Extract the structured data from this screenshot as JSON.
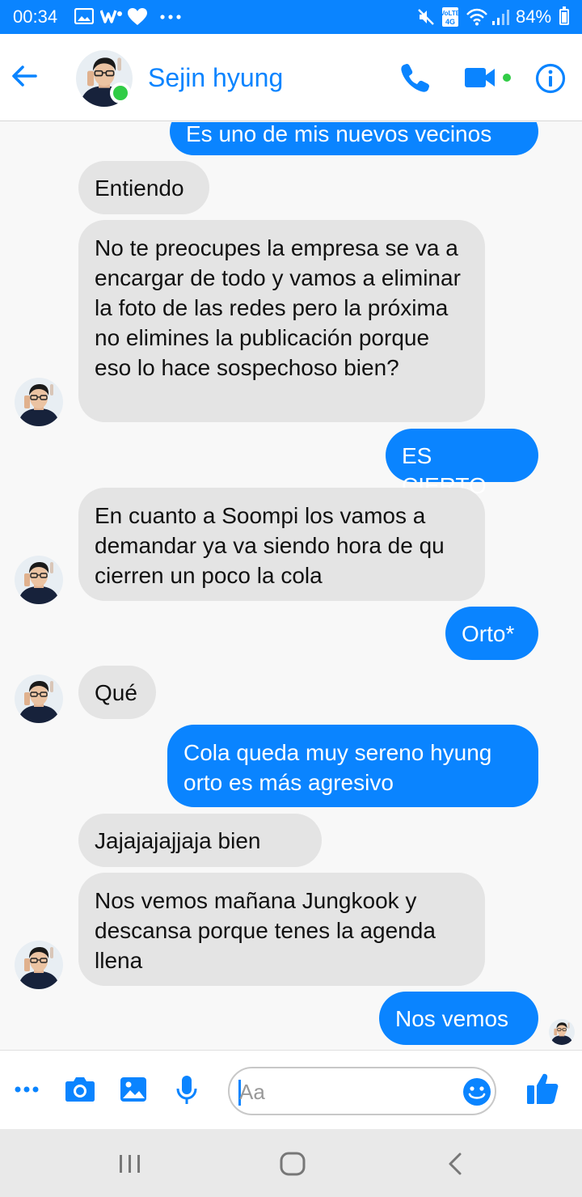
{
  "status_bar": {
    "time": "00:34",
    "battery": "84%",
    "notification_icons": [
      "image-icon",
      "w-icon",
      "heart-icon",
      "more-icon"
    ],
    "system_icons": [
      "mute-icon",
      "volte-icon",
      "wifi-icon",
      "signal-icon",
      "battery-icon"
    ]
  },
  "header": {
    "contact_name": "Sejin hyung",
    "online": true
  },
  "messages": [
    {
      "dir": "out",
      "text": "Es uno de mis nuevos vecinos"
    },
    {
      "dir": "in",
      "text": "Entiendo"
    },
    {
      "dir": "in",
      "text": "No te preocupes la empresa se va a encargar de todo y vamos a eliminar la foto de las redes pero la próxima no elimines la publicación porque eso lo hace sospechoso bien?"
    },
    {
      "dir": "out",
      "text": "ES CIERTO"
    },
    {
      "dir": "in",
      "text": "En cuanto a Soompi los vamos a demandar ya va siendo hora de qu cierren un poco la cola"
    },
    {
      "dir": "out",
      "text": "Orto*"
    },
    {
      "dir": "in",
      "text": "Qué"
    },
    {
      "dir": "out",
      "text": "Cola queda muy sereno hyung orto es más agresivo"
    },
    {
      "dir": "in",
      "text": "Jajajajajjaja bien"
    },
    {
      "dir": "in",
      "text": "Nos vemos mañana Jungkook y descansa porque tenes la agenda llena"
    },
    {
      "dir": "out",
      "text": "Nos vemos"
    }
  ],
  "composer": {
    "placeholder": "Aa"
  },
  "colors": {
    "accent": "#0a84ff",
    "incoming_bubble": "#e4e4e4",
    "online": "#31cc46"
  }
}
